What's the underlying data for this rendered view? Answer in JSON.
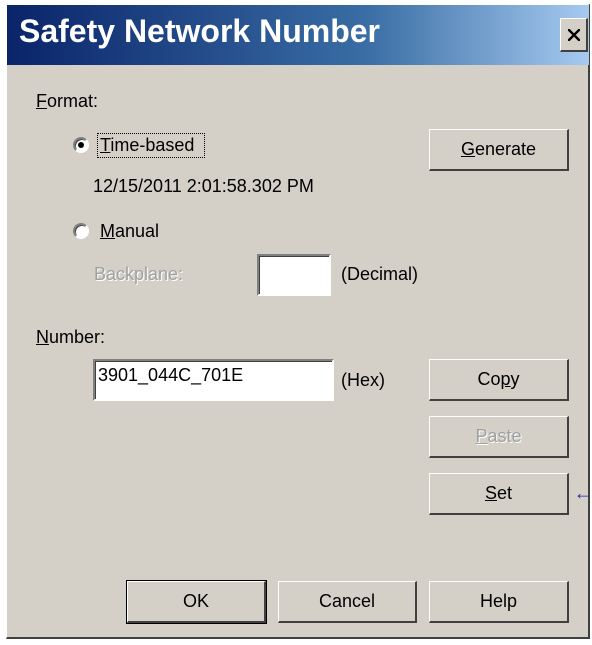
{
  "dialog": {
    "title": "Safety Network Number",
    "close_glyph": "×"
  },
  "format": {
    "label_first": "F",
    "label_rest": "ormat:",
    "time_based_first": "T",
    "time_based_rest": "ime-based",
    "time_based_selected": true,
    "timestamp": "12/15/2011 2:01:58.302 PM",
    "manual_first": "M",
    "manual_rest": "anual",
    "manual_selected": false,
    "backplane_label": "Backplane:",
    "backplane_value": "",
    "decimal_label": "(Decimal)",
    "generate_first": "G",
    "generate_rest": "enerate"
  },
  "number": {
    "label_first": "N",
    "label_rest": "umber:",
    "value": "3901_044C_701E",
    "hex_label": "(Hex)",
    "copy_pre": "Co",
    "copy_u": "p",
    "copy_post": "y",
    "paste_first": "P",
    "paste_rest": "aste",
    "set_first": "S",
    "set_rest": "et"
  },
  "footer": {
    "ok_label": "OK",
    "cancel_label": "Cancel",
    "help_label": "Help"
  },
  "annotation": {
    "arrow_glyph": "←",
    "arrow_color": "#1f1fa8"
  },
  "colors": {
    "dialog_face": "#d4d0c8",
    "title_start": "#0a246a",
    "title_end": "#a6caf0"
  }
}
